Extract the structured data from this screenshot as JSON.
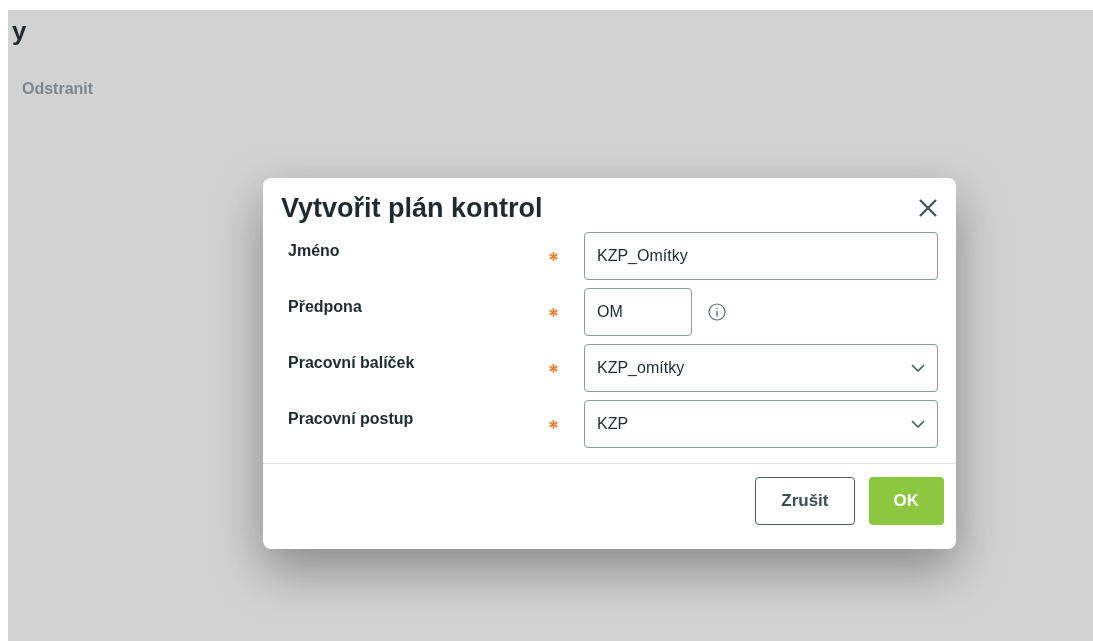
{
  "background": {
    "heading": "y",
    "action": "Odstranit"
  },
  "dialog": {
    "title": "Vytvořit plán kontrol",
    "fields": [
      {
        "kind": "text",
        "label": "Jméno",
        "required": true,
        "value": "KZP_Omítky"
      },
      {
        "kind": "short",
        "label": "Předpona",
        "required": true,
        "value": "OM"
      },
      {
        "kind": "select",
        "label": "Pracovní balíček",
        "required": true,
        "value": "KZP_omítky"
      },
      {
        "kind": "select",
        "label": "Pracovní postup",
        "required": true,
        "value": "KZP"
      }
    ],
    "buttons": [
      {
        "kind": "secondary",
        "label": "Zrušit"
      },
      {
        "kind": "primary",
        "label": "OK"
      }
    ]
  }
}
